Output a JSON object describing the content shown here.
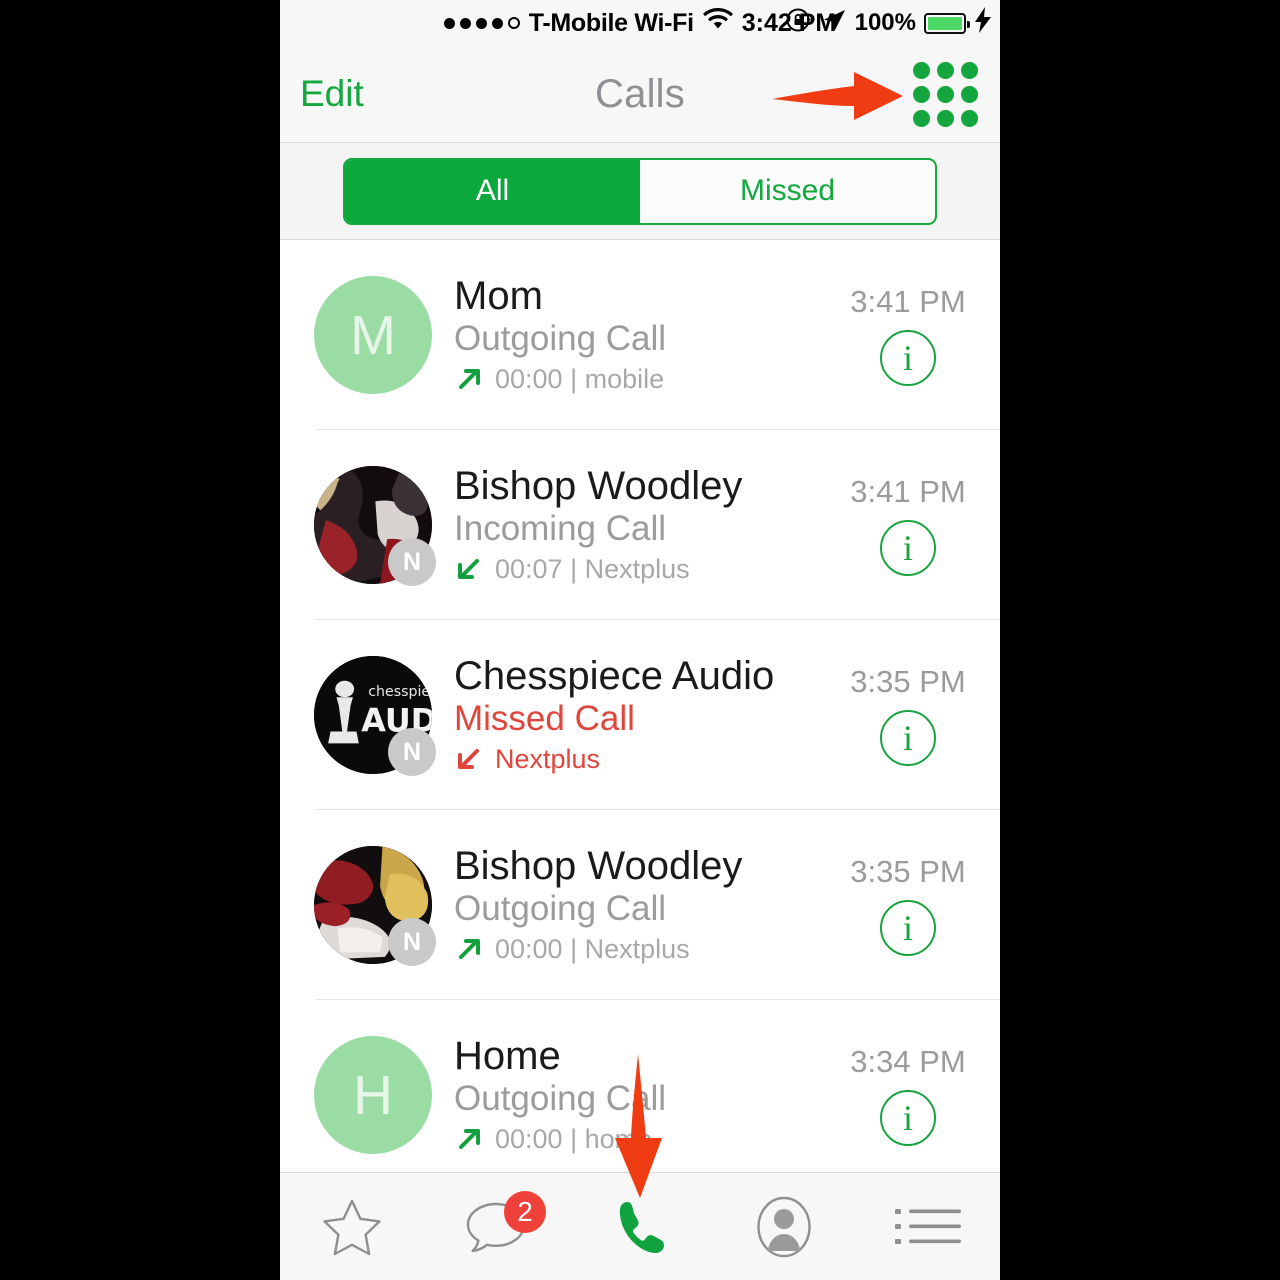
{
  "status_bar": {
    "signal_dots_filled": 4,
    "signal_dots_total": 5,
    "carrier": "T-Mobile Wi-Fi",
    "wifi_icon": "wifi-icon",
    "time": "3:42 PM",
    "rotation_lock_icon": "rotation-lock-icon",
    "location_icon": "location-arrow-icon",
    "battery_percent": "100%",
    "battery_charging_icon": "lightning-bolt-icon",
    "battery_color": "#4cd964"
  },
  "nav_bar": {
    "edit_label": "Edit",
    "title": "Calls",
    "keypad_icon": "keypad-grid-icon",
    "accent_color": "#12a83e"
  },
  "segmented_control": {
    "options": [
      {
        "label": "All",
        "selected": true
      },
      {
        "label": "Missed",
        "selected": false
      }
    ],
    "selected_color": "#0ba83c",
    "border_color": "#12a83e"
  },
  "calls": [
    {
      "name": "Mom",
      "call_type": "Outgoing Call",
      "direction": "outgoing",
      "duration": "00:00",
      "separator": "|",
      "line": "mobile",
      "meta": "00:00 | mobile",
      "time": "3:41 PM",
      "avatar_kind": "initial",
      "avatar_initial": "M",
      "nextplus_badge": false,
      "missed": false,
      "info_icon": "info-icon"
    },
    {
      "name": "Bishop Woodley",
      "call_type": "Incoming Call",
      "direction": "incoming",
      "duration": "00:07",
      "separator": "|",
      "line": "Nextplus",
      "meta": "00:07 | Nextplus",
      "time": "3:41 PM",
      "avatar_kind": "photo-dark-red",
      "avatar_initial": "",
      "nextplus_badge": true,
      "nextplus_badge_letter": "N",
      "missed": false,
      "info_icon": "info-icon"
    },
    {
      "name": "Chesspiece Audio",
      "call_type": "Missed Call",
      "direction": "incoming",
      "duration": "",
      "separator": "",
      "line": "Nextplus",
      "meta": "Nextplus",
      "time": "3:35 PM",
      "avatar_kind": "photo-logo-black",
      "avatar_initial": "",
      "avatar_logo_top": "chesspiece",
      "avatar_logo_bottom": "AUDIO",
      "nextplus_badge": true,
      "nextplus_badge_letter": "N",
      "missed": true,
      "info_icon": "info-icon"
    },
    {
      "name": "Bishop Woodley",
      "call_type": "Outgoing Call",
      "direction": "outgoing",
      "duration": "00:00",
      "separator": "|",
      "line": "Nextplus",
      "meta": "00:00 | Nextplus",
      "time": "3:35 PM",
      "avatar_kind": "photo-car-red",
      "avatar_initial": "",
      "nextplus_badge": true,
      "nextplus_badge_letter": "N",
      "missed": false,
      "info_icon": "info-icon"
    },
    {
      "name": "Home",
      "call_type": "Outgoing Call",
      "direction": "outgoing",
      "duration": "00:00",
      "separator": "|",
      "line": "home",
      "meta": "00:00 | home",
      "time": "3:34 PM",
      "avatar_kind": "initial",
      "avatar_initial": "H",
      "nextplus_badge": false,
      "missed": false,
      "info_icon": "info-icon"
    }
  ],
  "tab_bar": {
    "tabs": [
      {
        "icon": "star-icon",
        "active": false,
        "badge": null
      },
      {
        "icon": "chat-bubble-icon",
        "active": false,
        "badge": "2"
      },
      {
        "icon": "phone-handset-icon",
        "active": true,
        "badge": null
      },
      {
        "icon": "contact-person-icon",
        "active": false,
        "badge": null
      },
      {
        "icon": "list-lines-icon",
        "active": false,
        "badge": null
      }
    ],
    "active_color": "#10a23c",
    "inactive_color": "#8f8f8f",
    "badge_color": "#f0403a"
  },
  "annotations": [
    {
      "name": "arrow-pointing-to-keypad",
      "direction": "right",
      "color": "#f03c12"
    },
    {
      "name": "arrow-pointing-to-phone-tab",
      "direction": "down",
      "color": "#f03c12"
    }
  ],
  "colors": {
    "missed_red": "#e0453c",
    "green_accent": "#12a83e",
    "annotation_red": "#f03c12"
  }
}
